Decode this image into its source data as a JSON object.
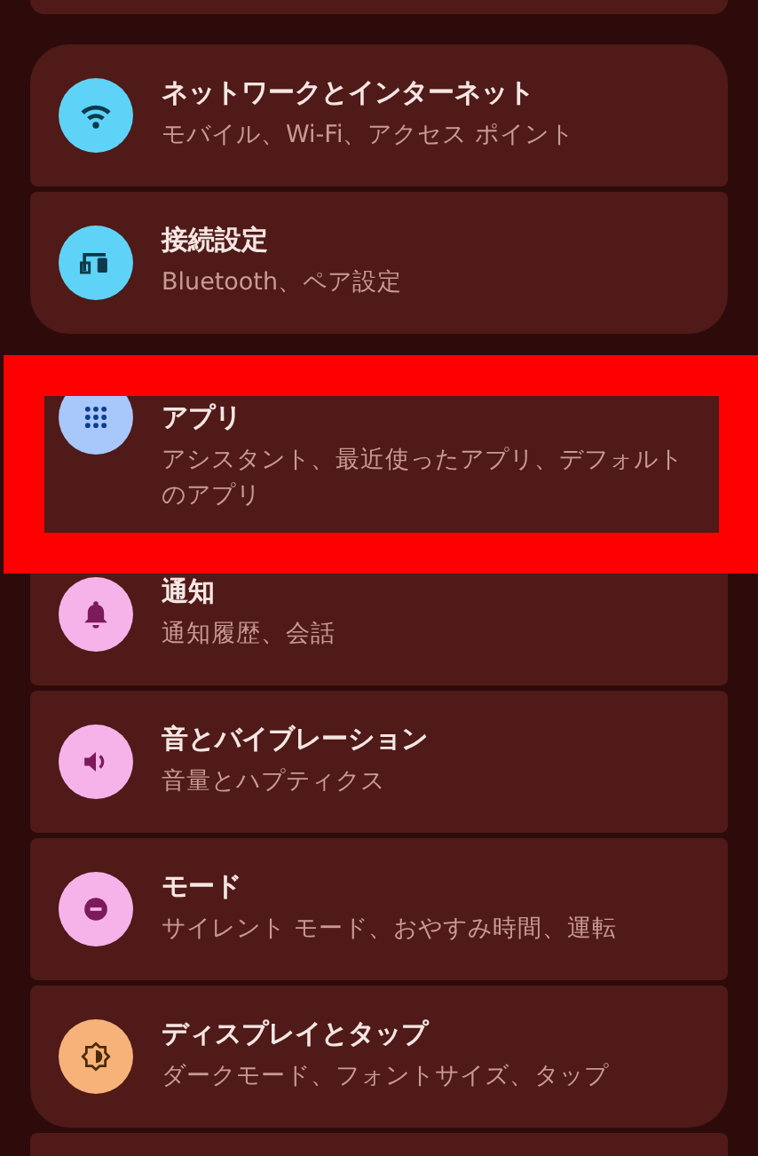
{
  "groups": [
    {
      "items": [
        {
          "kind": "wifi",
          "color": "#5ed3f7",
          "title": "ネットワークとインターネット",
          "subtitle": "モバイル、Wi-Fi、アクセス ポイント",
          "highlighted": false
        },
        {
          "kind": "devices",
          "color": "#5ed3f7",
          "title": "接続設定",
          "subtitle": "Bluetooth、ペア設定",
          "highlighted": false
        }
      ]
    },
    {
      "items": [
        {
          "kind": "apps",
          "color": "#a8c7fa",
          "title": "アプリ",
          "subtitle": "アシスタント、最近使ったアプリ、デフォルトのアプリ",
          "highlighted": true
        },
        {
          "kind": "bell",
          "color": "#f6b3e9",
          "title": "通知",
          "subtitle": "通知履歴、会話",
          "highlighted": false
        },
        {
          "kind": "sound",
          "color": "#f6b3e9",
          "title": "音とバイブレーション",
          "subtitle": "音量とハプティクス",
          "highlighted": false
        },
        {
          "kind": "mode",
          "color": "#f6b3e9",
          "title": "モード",
          "subtitle": "サイレント モード、おやすみ時間、運転",
          "highlighted": false
        },
        {
          "kind": "display",
          "color": "#f7b27a",
          "title": "ディスプレイとタップ",
          "subtitle": "ダークモード、フォントサイズ、タップ",
          "highlighted": false
        }
      ]
    }
  ]
}
